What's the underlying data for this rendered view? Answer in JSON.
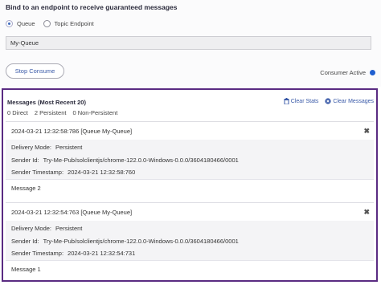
{
  "bind": {
    "title": "Bind to an endpoint to receive guaranteed messages",
    "options": [
      {
        "label": "Queue",
        "selected": true
      },
      {
        "label": "Topic Endpoint",
        "selected": false
      }
    ],
    "queue_value": "My-Queue",
    "stop_label": "Stop Consume",
    "consumer_status": "Consumer Active",
    "consumer_status_color": "#1f5fd0"
  },
  "messages": {
    "title": "Messages",
    "subtitle": "(Most Recent 20)",
    "stats": {
      "direct": "0 Direct",
      "persistent": "2 Persistent",
      "non_persistent": "0 Non-Persistent"
    },
    "clear_stats_label": "Clear Stats",
    "clear_messages_label": "Clear Messages",
    "items": [
      {
        "header": "2024-03-21 12:32:58:786 [Queue My-Queue]",
        "delivery_mode_key": "Delivery Mode:",
        "delivery_mode": "Persistent",
        "sender_id_key": "Sender Id:",
        "sender_id": "Try-Me-Pub/solclientjs/chrome-122.0.0-Windows-0.0.0/3604180466/0001",
        "sender_ts_key": "Sender Timestamp:",
        "sender_ts": "2024-03-21 12:32:58:760",
        "text": "Message 2"
      },
      {
        "header": "2024-03-21 12:32:54:763 [Queue My-Queue]",
        "delivery_mode_key": "Delivery Mode:",
        "delivery_mode": "Persistent",
        "sender_id_key": "Sender Id:",
        "sender_id": "Try-Me-Pub/solclientjs/chrome-122.0.0-Windows-0.0.0/3604180466/0001",
        "sender_ts_key": "Sender Timestamp:",
        "sender_ts": "2024-03-21 12:32:54:731",
        "text": "Message 1"
      }
    ]
  },
  "accent_color": "#5a2b82"
}
